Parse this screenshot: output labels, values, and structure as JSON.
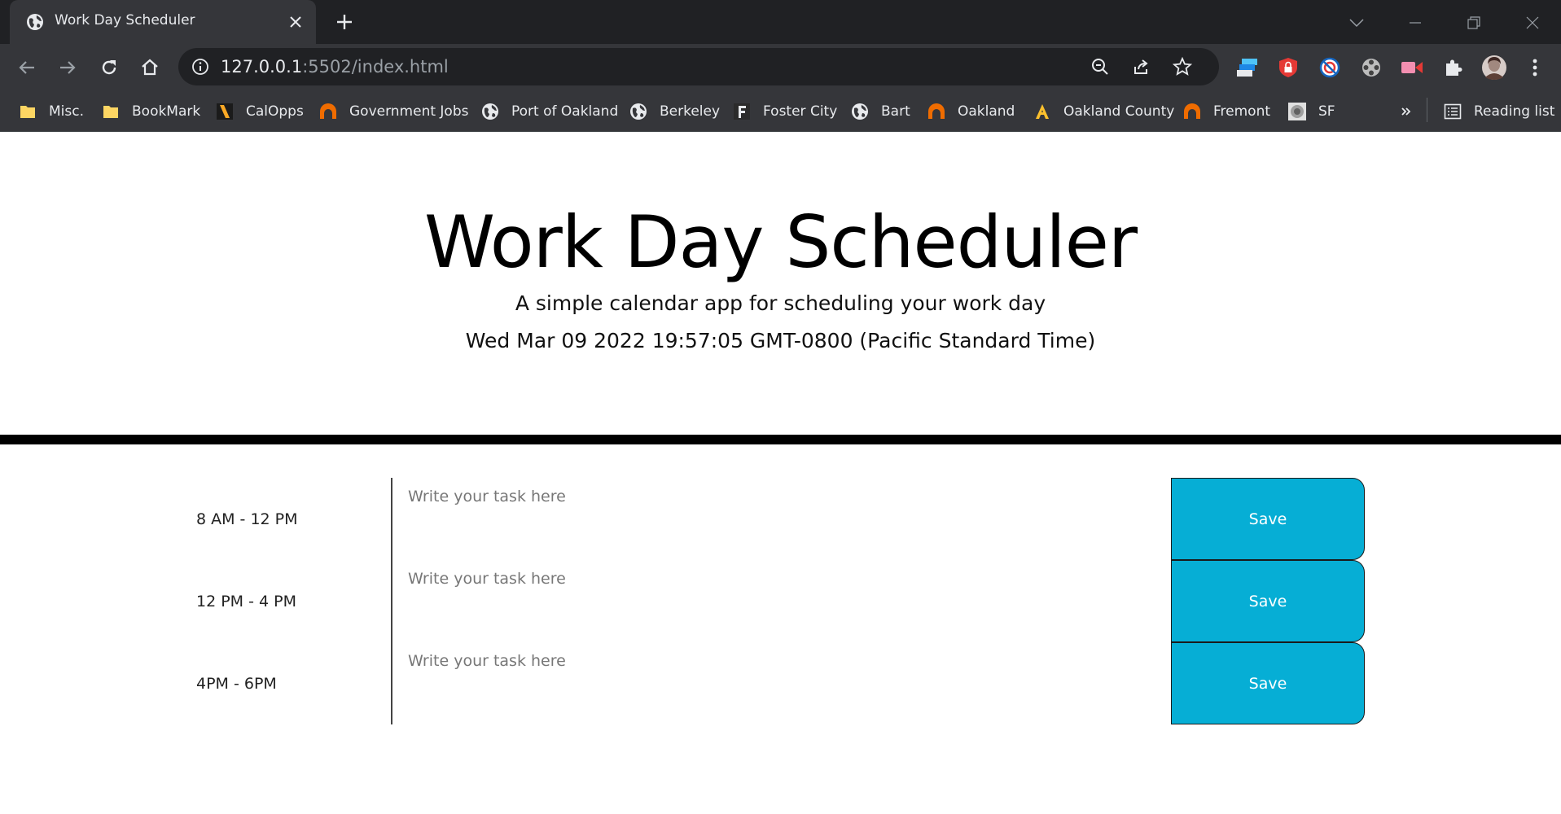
{
  "browser": {
    "tab": {
      "title": "Work Day Scheduler"
    },
    "address": {
      "host": "127.0.0.1",
      "path": ":5502/index.html"
    },
    "bookmarks": [
      {
        "label": "Misc.",
        "icon": "folder-icon"
      },
      {
        "label": "BookMark",
        "icon": "folder-icon"
      },
      {
        "label": "CalOpps",
        "icon": "calopps-icon"
      },
      {
        "label": "Government Jobs",
        "icon": "govjobs-icon"
      },
      {
        "label": "Port of Oakland",
        "icon": "globe-icon"
      },
      {
        "label": "Berkeley",
        "icon": "globe-icon"
      },
      {
        "label": "Foster City",
        "icon": "f-letter-icon"
      },
      {
        "label": "Bart",
        "icon": "globe-icon"
      },
      {
        "label": "Oakland",
        "icon": "govjobs-icon"
      },
      {
        "label": "Oakland County",
        "icon": "a-letter-icon"
      },
      {
        "label": "Fremont",
        "icon": "govjobs-icon"
      },
      {
        "label": "SF",
        "icon": "seal-icon"
      }
    ],
    "reading_list": "Reading list",
    "colors": {
      "tabstrip": "#202124",
      "toolbar": "#35363a",
      "text": "#e8eaed"
    }
  },
  "page": {
    "title": "Work Day Scheduler",
    "lead": "A simple calendar app for scheduling your work day",
    "current_date": "Wed Mar 09 2022 19:57:05 GMT-0800 (Pacific Standard Time)",
    "time_blocks": [
      {
        "hour": "8 AM - 12 PM",
        "placeholder": "Write your task here",
        "value": "",
        "save_label": "Save"
      },
      {
        "hour": "12 PM - 4 PM",
        "placeholder": "Write your task here",
        "value": "",
        "save_label": "Save"
      },
      {
        "hour": "4PM - 6PM",
        "placeholder": "Write your task here",
        "value": "",
        "save_label": "Save"
      }
    ],
    "colors": {
      "save_button": "#06aed5",
      "divider": "#000000"
    }
  }
}
